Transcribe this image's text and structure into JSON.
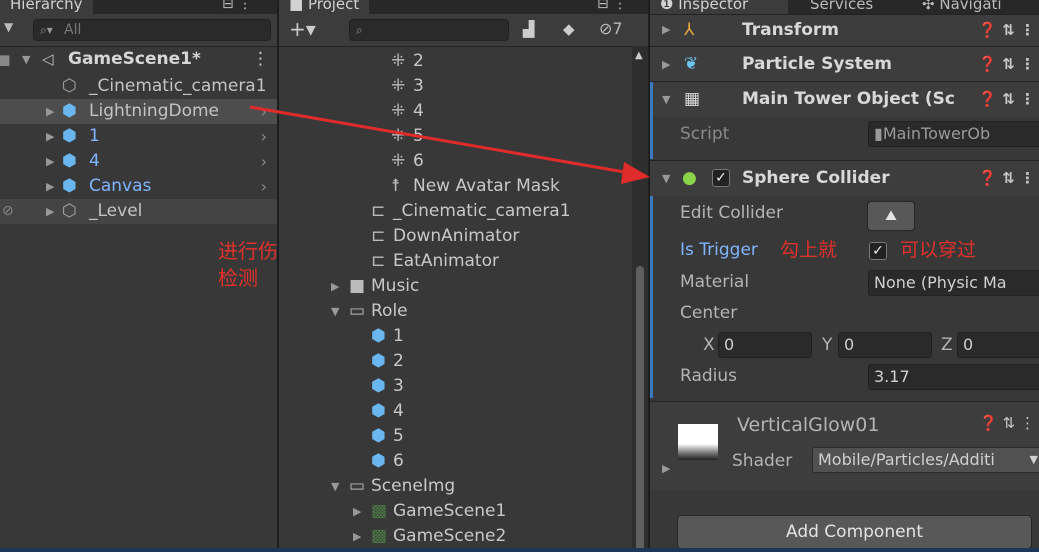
{
  "hierarchy": {
    "tab": "Hierarchy",
    "search_placeholder": "All",
    "scene": "GameScene1*",
    "items": [
      {
        "label": "_Cinematic_camera1"
      },
      {
        "label": "LightningDome"
      },
      {
        "label": "1"
      },
      {
        "label": "4"
      },
      {
        "label": "Canvas"
      },
      {
        "label": "_Level"
      }
    ],
    "annotation": "进行伤害\n检测"
  },
  "project": {
    "tab": "Project",
    "hidden_count": "7",
    "items": [
      {
        "label": "2"
      },
      {
        "label": "3"
      },
      {
        "label": "4"
      },
      {
        "label": "5"
      },
      {
        "label": "6"
      },
      {
        "label": "New Avatar Mask"
      },
      {
        "label": "_Cinematic_camera1"
      },
      {
        "label": "DownAnimator"
      },
      {
        "label": "EatAnimator"
      },
      {
        "label": "Music"
      },
      {
        "label": "Role"
      },
      {
        "label": "1"
      },
      {
        "label": "2"
      },
      {
        "label": "3"
      },
      {
        "label": "4"
      },
      {
        "label": "5"
      },
      {
        "label": "6"
      },
      {
        "label": "SceneImg"
      },
      {
        "label": "GameScene1"
      },
      {
        "label": "GameScene2"
      }
    ]
  },
  "inspector": {
    "tabs": [
      "Inspector",
      "Services",
      "Navigati"
    ],
    "components": {
      "transform": "Transform",
      "particle": "Particle System",
      "tower": "Main Tower Object (Sc",
      "collider": "Sphere Collider"
    },
    "script_label": "Script",
    "script_value": "MainTowerOb",
    "edit_collider": "Edit Collider",
    "is_trigger": "Is Trigger",
    "ann_check": "勾上就",
    "ann_pass": "可以穿过",
    "material_label": "Material",
    "material_value": "None (Physic Ma",
    "center_label": "Center",
    "x_label": "X",
    "x_value": "0",
    "y_label": "Y",
    "y_value": "0",
    "z_label": "Z",
    "z_value": "0",
    "radius_label": "Radius",
    "radius_value": "3.17",
    "material_name": "VerticalGlow01",
    "shader_label": "Shader",
    "shader_value": "Mobile/Particles/Additi",
    "add_component": "Add Component"
  },
  "colors": {
    "accent": "#3a79bb",
    "annotation": "#e0312b",
    "link": "#7fb5ff"
  }
}
